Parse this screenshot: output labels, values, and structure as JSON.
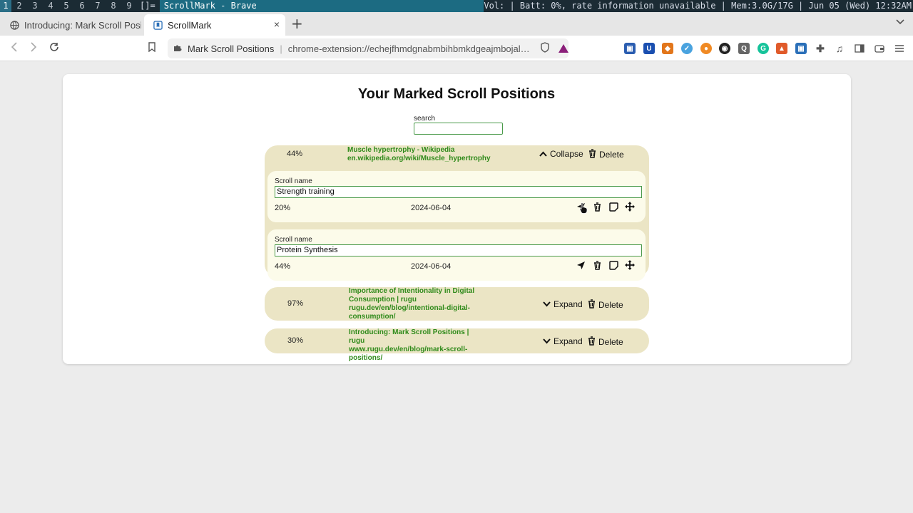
{
  "wm": {
    "workspaces": [
      "1",
      "2",
      "3",
      "4",
      "5",
      "6",
      "7",
      "8",
      "9"
    ],
    "active_workspace": "1",
    "layout": "[]=",
    "window_title": "ScrollMark - Brave",
    "status": "Vol: | Batt: 0%, rate information unavailable | Mem:3.0G/17G | Jun 05 (Wed) 12:32AM"
  },
  "tabs": [
    {
      "label": "Introducing: Mark Scroll Posi"
    },
    {
      "label": "ScrollMark",
      "close": "×"
    }
  ],
  "toolbar": {
    "site_name": "Mark Scroll Positions",
    "url": "chrome-extension://echejfhmdgnabmbihbmkdgeajmbojald/man..."
  },
  "page": {
    "title": "Your Marked Scroll Positions",
    "search_label": "search",
    "search_value": ""
  },
  "groups": [
    {
      "percent": "44%",
      "title": "Muscle hypertrophy - Wikipedia",
      "url": "en.wikipedia.org/wiki/Muscle_hypertrophy",
      "toggle_label": "Collapse",
      "delete_label": "Delete",
      "expanded": true,
      "items": [
        {
          "name_label": "Scroll name",
          "name": "Strength training",
          "percent": "20%",
          "date": "2024-06-04"
        },
        {
          "name_label": "Scroll name",
          "name": "Protein Synthesis",
          "percent": "44%",
          "date": "2024-06-04"
        }
      ]
    },
    {
      "percent": "97%",
      "title": "Importance of Intentionality in Digital Consumption | rugu",
      "url": "rugu.dev/en/blog/intentional-digital-consumption/",
      "toggle_label": "Expand",
      "delete_label": "Delete",
      "expanded": false
    },
    {
      "percent": "30%",
      "title": "Introducing: Mark Scroll Positions | rugu",
      "url": "www.rugu.dev/en/blog/mark-scroll-positions/",
      "toggle_label": "Expand",
      "delete_label": "Delete",
      "expanded": false
    }
  ],
  "colors": {
    "group_bg": "#ebe5c5",
    "item_bg": "#fcfbea",
    "link_green": "#2f8a1a",
    "wm_title_bg": "#1c6b82"
  }
}
